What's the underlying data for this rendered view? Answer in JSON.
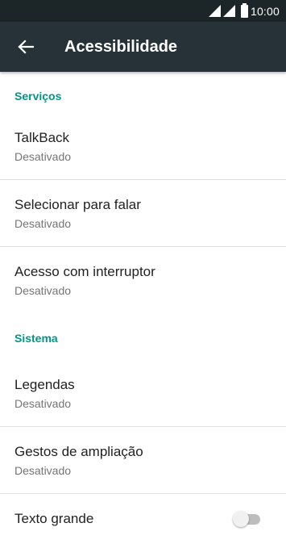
{
  "status_bar": {
    "time": "10:00"
  },
  "app_bar": {
    "title": "Acessibilidade",
    "back_icon": "arrow-left-icon"
  },
  "sections": {
    "services": {
      "header": "Serviços",
      "items": [
        {
          "title": "TalkBack",
          "subtitle": "Desativado"
        },
        {
          "title": "Selecionar para falar",
          "subtitle": "Desativado"
        },
        {
          "title": "Acesso com interruptor",
          "subtitle": "Desativado"
        }
      ]
    },
    "system": {
      "header": "Sistema",
      "items": [
        {
          "title": "Legendas",
          "subtitle": "Desativado"
        },
        {
          "title": "Gestos de ampliação",
          "subtitle": "Desativado"
        },
        {
          "title": "Texto grande",
          "toggle_on": false
        }
      ]
    }
  },
  "colors": {
    "accent": "#009688",
    "app_bar": "#263238",
    "status_bar": "#1c2528"
  }
}
